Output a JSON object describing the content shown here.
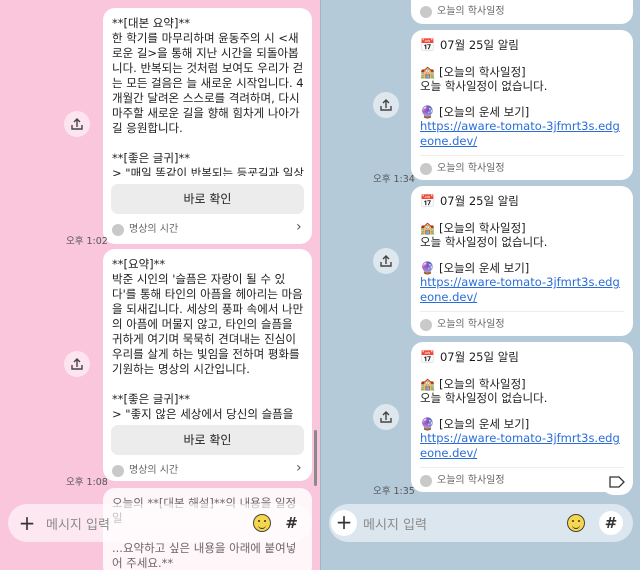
{
  "left": {
    "msg1": {
      "text": "**[대본 요약]**\n한 학기를 마무리하며 윤동주의 시 <새로운 길>을 통해 지난 시간을 되돌아봅니다. 반복되는 것처럼 보여도 우리가 걷는 모든 걸음은 늘 새로운 시작입니다. 4개월간 달려온 스스로를 격려하며, 다시 마주할 새로운 길을 향해 힘차게 나아가길 응원합니다.\n\n**[좋은 글귀]**\n> \"매일 똑같이 반복되는 등굣길과 일상 같지만, 사실 우리가",
      "button": "바로 확인",
      "footer": "명상의 시간",
      "time": "오후 1:02"
    },
    "msg2": {
      "text": "**[요약]**\n박준 시인의 '슬픔은 자랑이 될 수 있다'를 통해 타인의 아픔을 헤아리는 마음을 되새깁니다. 세상의 풍파 속에서 나만의 아픔에 머물지 않고, 타인의 슬픔을 귀하게 여기며 묵묵히 견뎌내는 진심이 우리를 살게 하는 빛임을 전하며 평화를 기원하는 명상의 시간입니다.\n\n**[좋은 글귀]**\n> \"좋지 않은 세상에서 당신의 슬픔을 생각하는 것은...",
      "button": "바로 확인",
      "footer": "명상의 시간",
      "time": "오후 1:08"
    },
    "msg3": {
      "text": "오늘의 **[대본 해설]**의 내용을 일정 일\n\n...요약하고 싶은 내용을 아래에 붙여넣어 주세요.**"
    },
    "input_placeholder": "메시지 입력",
    "hash": "#"
  },
  "right": {
    "top_footer": "오늘의 학사일정",
    "cards": [
      {
        "date": "07월 25일 알림",
        "sched_label": "[오늘의 학사일정]",
        "sched_text": "오늘 학사일정이 없습니다.",
        "fortune_label": "[오늘의 운세 보기]",
        "url": "https://aware-tomato-3jfmrt3s.edgeone.dev/",
        "footer": "오늘의 학사일정",
        "time": "오후 1:34"
      },
      {
        "date": "07월 25일 알림",
        "sched_label": "[오늘의 학사일정]",
        "sched_text": "오늘 학사일정이 없습니다.",
        "fortune_label": "[오늘의 운세 보기]",
        "url": "https://aware-tomato-3jfmrt3s.edgeone.dev/",
        "footer": "오늘의 학사일정",
        "time": ""
      },
      {
        "date": "07월 25일 알림",
        "sched_label": "[오늘의 학사일정]",
        "sched_text": "오늘 학사일정이 없습니다.",
        "fortune_label": "[오늘의 운세 보기]",
        "url": "https://aware-tomato-3jfmrt3s.edgeone.dev/",
        "footer": "오늘의 학사일정",
        "time": "오후 1:35"
      }
    ],
    "input_placeholder": "메시지 입력",
    "hash": "#"
  },
  "colors": {
    "left_bg": "#f9c6dc",
    "right_bg": "#b5cad8",
    "link": "#2a6dd6"
  },
  "icons": [
    "share-icon",
    "chevron-right-icon",
    "plus-icon",
    "emoji-icon",
    "calendar-icon",
    "school-icon",
    "crystal-ball-icon",
    "tag-icon"
  ]
}
